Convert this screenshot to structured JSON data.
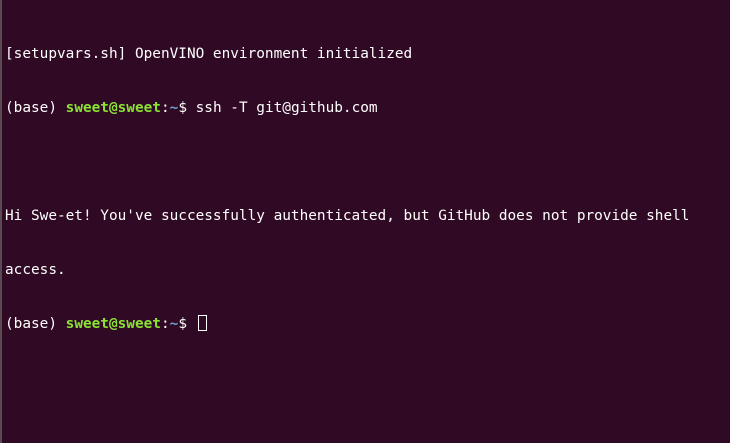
{
  "terminal": {
    "line1": "[setupvars.sh] OpenVINO environment initialized",
    "line2": {
      "env": "(base) ",
      "user_host": "sweet@sweet",
      "sep": ":",
      "path": "~",
      "symbol": "$ ",
      "command": "ssh -T git@github.com"
    },
    "line4": "Hi Swe-et! You've successfully authenticated, but GitHub does not provide shell",
    "line5": "access.",
    "line6": {
      "env": "(base) ",
      "user_host": "sweet@sweet",
      "sep": ":",
      "path": "~",
      "symbol": "$ "
    }
  },
  "colors": {
    "background": "#300a24",
    "text": "#ffffff",
    "user_host": "#8ae234",
    "path": "#729fcf"
  }
}
